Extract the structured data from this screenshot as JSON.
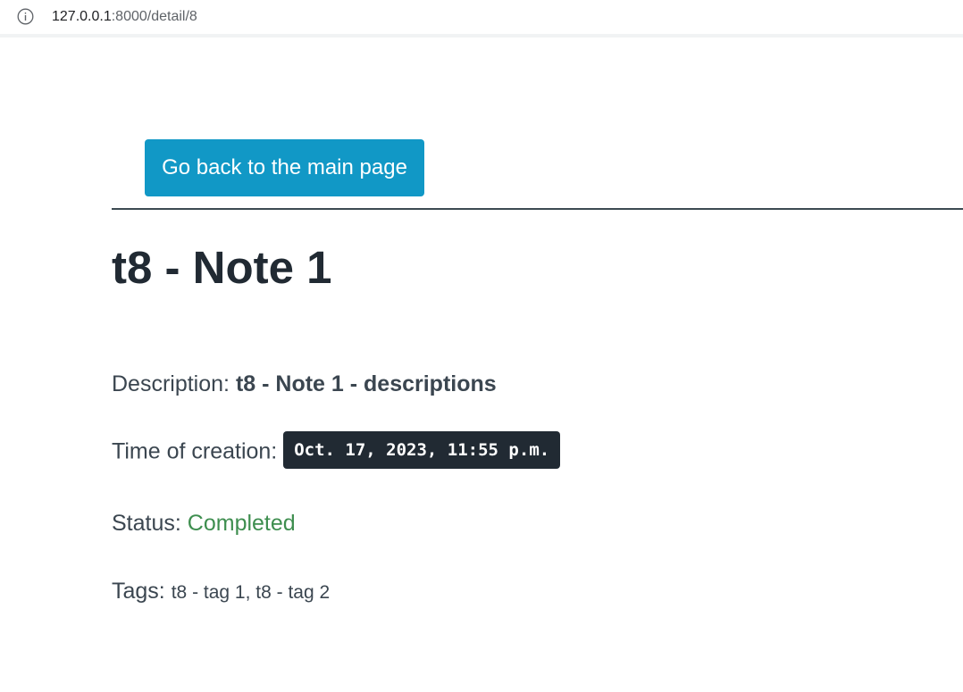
{
  "browser": {
    "url_host": "127.0.0.1",
    "url_rest": ":8000/detail/8",
    "info_icon": "info-icon"
  },
  "page": {
    "back_button_label": "Go back to the main page",
    "title": "t8 - Note 1",
    "description_label": "Description:",
    "description_value": "t8 - Note 1 - descriptions",
    "time_label": "Time of creation:",
    "time_value": "Oct. 17, 2023, 11:55 p.m.",
    "status_label": "Status:",
    "status_value": "Completed",
    "tags_label": "Tags:",
    "tags_value": "t8 - tag 1, t8 - tag 2"
  },
  "colors": {
    "button_bg": "#1198c6",
    "status_completed": "#3e8e4f",
    "badge_bg": "#212a33"
  }
}
